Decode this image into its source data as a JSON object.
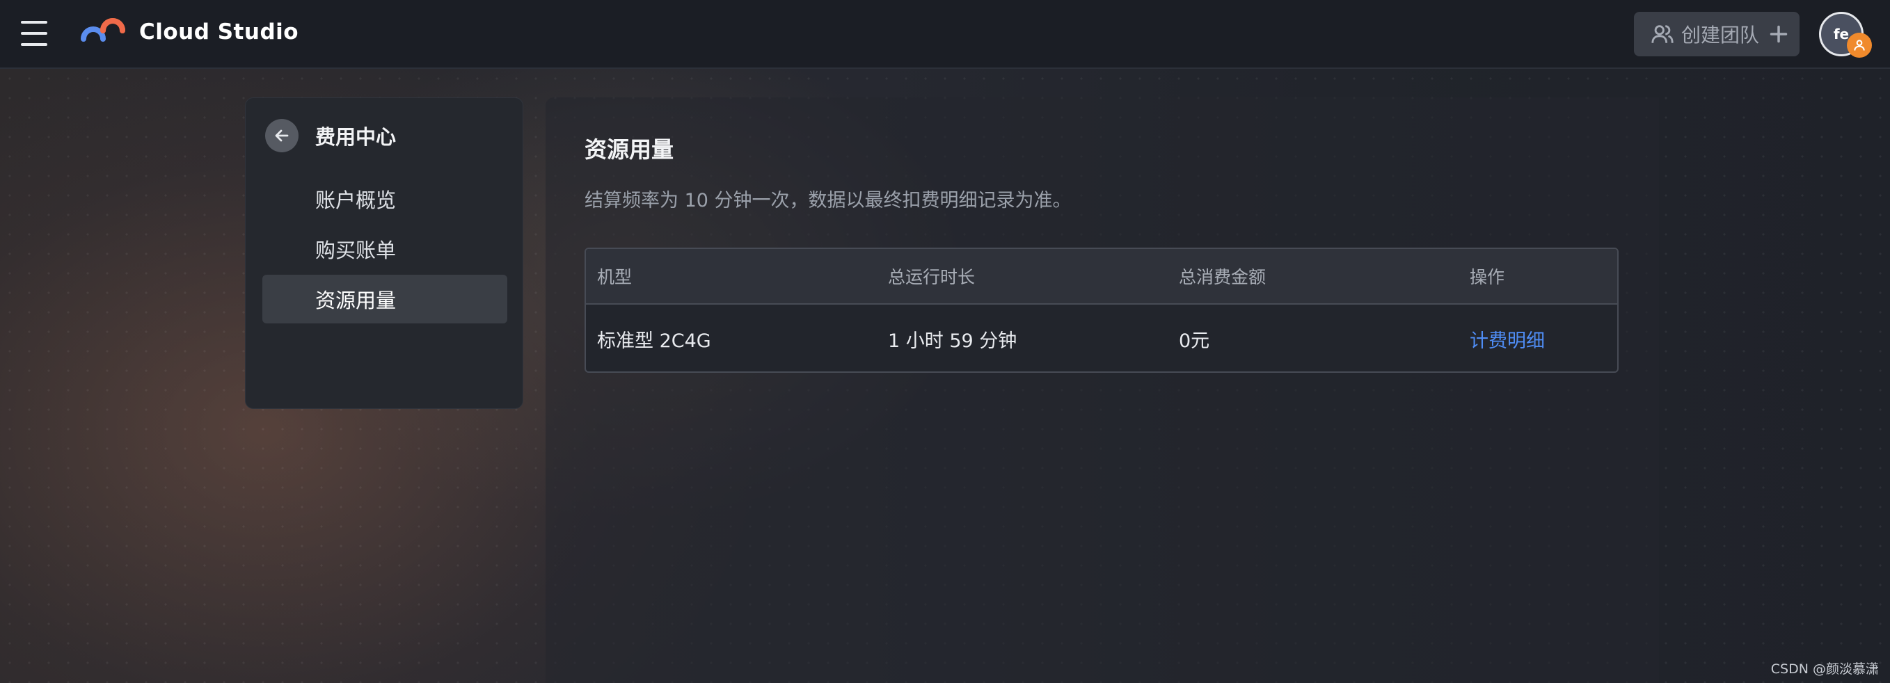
{
  "header": {
    "brand": "Cloud Studio",
    "create_team_label": "创建团队",
    "avatar_initials": "fe"
  },
  "sidebar": {
    "title": "费用中心",
    "items": [
      {
        "label": "账户概览",
        "active": false
      },
      {
        "label": "购买账单",
        "active": false
      },
      {
        "label": "资源用量",
        "active": true
      }
    ]
  },
  "main": {
    "title": "资源用量",
    "description": "结算频率为 10 分钟一次，数据以最终扣费明细记录为准。",
    "table": {
      "columns": [
        "机型",
        "总运行时长",
        "总消费金额",
        "操作"
      ],
      "rows": [
        {
          "model": "标准型 2C4G",
          "duration": "1 小时 59 分钟",
          "amount": "0元",
          "action": "计费明细"
        }
      ]
    }
  },
  "watermark": "CSDN @颜淡慕潇",
  "colors": {
    "header_bg": "#1b1e25",
    "link": "#4f8df5",
    "logo_orange": "#f08a2c",
    "logo_blue": "#5b8dee",
    "badge": "#f08a2c"
  },
  "icons": [
    "menu-icon",
    "cloud-studio-logo-icon",
    "team-icon",
    "plus-icon",
    "user-badge-icon",
    "arrow-left-icon"
  ]
}
